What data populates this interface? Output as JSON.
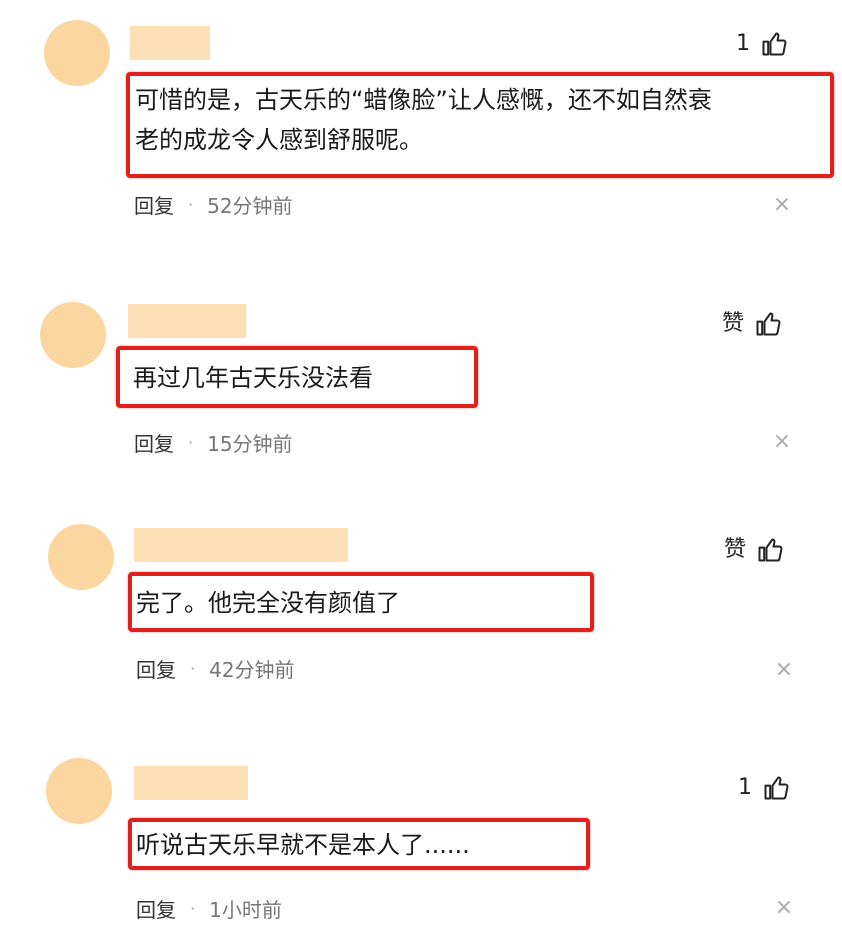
{
  "colors": {
    "avatar": "#fcd6a0",
    "name_placeholder": "#fde0b6",
    "highlight_border": "#e0201d"
  },
  "comments": [
    {
      "like_label": "1",
      "text_line1": "可惜的是，古天乐的“蜡像脸”让人感慨，还不如自然衰",
      "text_line2": "老的成龙令人感到舒服呢。",
      "reply_label": "回复",
      "separator": "·",
      "time": "52分钟前",
      "close_glyph": "×"
    },
    {
      "like_label": "赞",
      "text_line1": "再过几年古天乐没法看",
      "reply_label": "回复",
      "separator": "·",
      "time": "15分钟前",
      "close_glyph": "×"
    },
    {
      "like_label": "赞",
      "text_line1": "完了。他完全没有颜值了",
      "reply_label": "回复",
      "separator": "·",
      "time": "42分钟前",
      "close_glyph": "×"
    },
    {
      "like_label": "1",
      "text_line1": "听说古天乐早就不是本人了......",
      "reply_label": "回复",
      "separator": "·",
      "time": "1小时前",
      "close_glyph": "×"
    }
  ]
}
